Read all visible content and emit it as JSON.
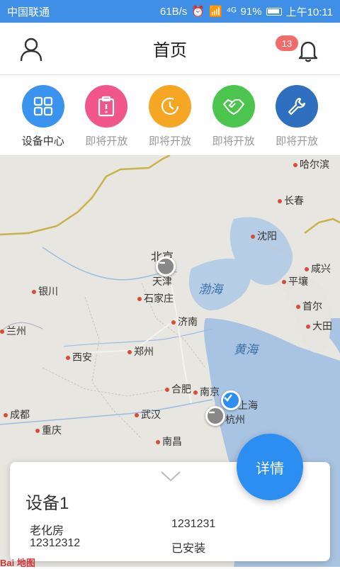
{
  "status_bar": {
    "carrier": "中国联通",
    "speed": "61B/s",
    "signal": "⁴ᴳ",
    "battery": "91%",
    "time": "上午10:11"
  },
  "header": {
    "title": "首页",
    "badge_count": "13"
  },
  "quick_menu": [
    {
      "label": "设备中心",
      "color": "#3a93ef",
      "icon": "grid-icon"
    },
    {
      "label": "即将开放",
      "color": "#f0568a",
      "icon": "clipboard-icon"
    },
    {
      "label": "即将开放",
      "color": "#f5a623",
      "icon": "clock-icon"
    },
    {
      "label": "即将开放",
      "color": "#4cc54e",
      "icon": "handshake-icon"
    },
    {
      "label": "即将开放",
      "color": "#2f6fbf",
      "icon": "wrench-icon"
    }
  ],
  "map": {
    "cities": [
      "哈尔滨",
      "长春",
      "沈阳",
      "咸兴",
      "北京",
      "天津",
      "石家庄",
      "银川",
      "兰州",
      "平壤",
      "首尔",
      "大田",
      "济南",
      "郑州",
      "西安",
      "合肥",
      "南京",
      "上海",
      "杭州",
      "武汉",
      "成都",
      "重庆",
      "南昌"
    ],
    "seas": [
      "渤海",
      "黄海"
    ],
    "attribution": "Bai 地图"
  },
  "device_card": {
    "name": "设备1",
    "field1": "老化房",
    "field2": "12312312",
    "field3": "1231231",
    "field4": "已安装"
  },
  "detail_button": "详情"
}
